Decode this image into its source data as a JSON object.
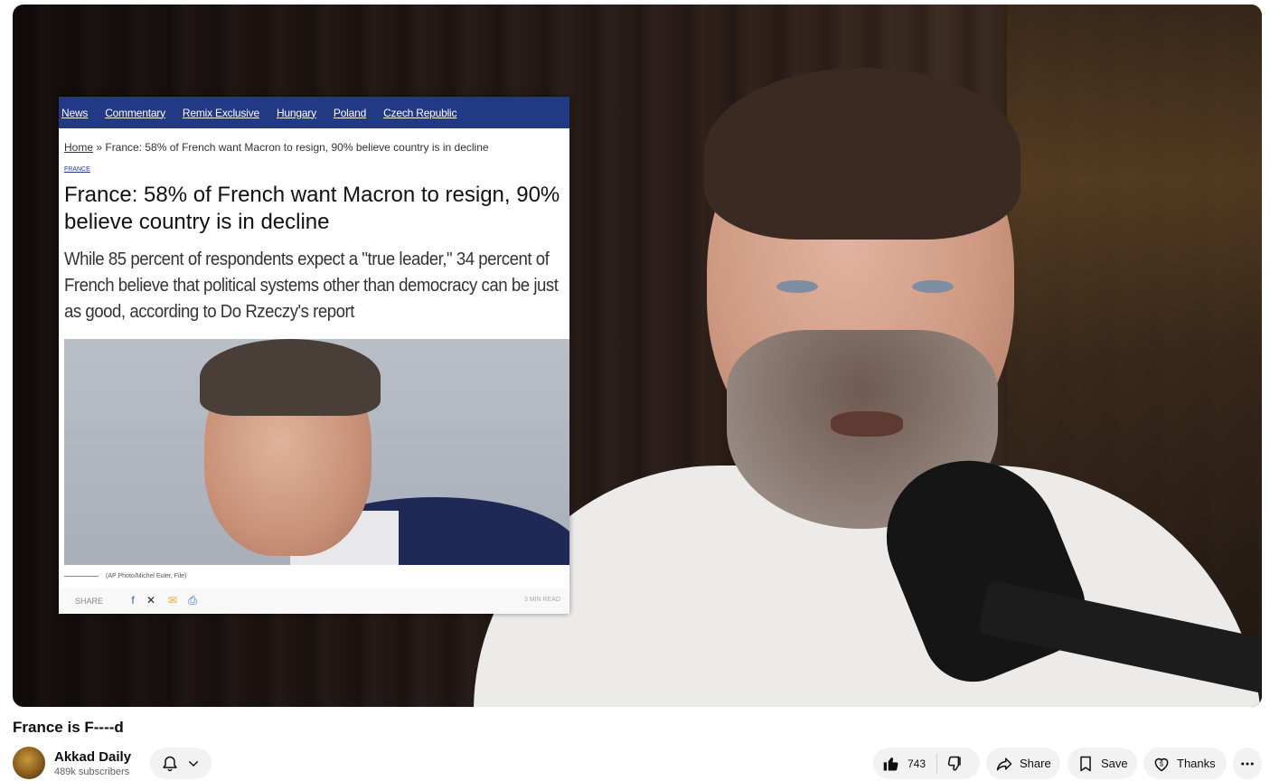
{
  "article": {
    "nav": [
      "News",
      "Commentary",
      "Remix Exclusive",
      "Hungary",
      "Poland",
      "Czech Republic"
    ],
    "breadcrumb_home": "Home",
    "breadcrumb_rest": " » France: 58% of French want Macron to resign, 90% believe country is in decline",
    "category": "FRANCE",
    "headline": "France: 58% of French want Macron to resign, 90% believe country is in decline",
    "dek": "While 85 percent of respondents expect a \"true leader,\" 34 percent of French believe that political systems other than democracy can be just as good, according to Do Rzeczy's report",
    "caption": "(AP Photo/Michel Euler, File)",
    "share_label": "SHARE",
    "read_time": "3 MIN READ"
  },
  "video": {
    "title": "France is F----d"
  },
  "channel": {
    "name": "Akkad Daily",
    "subscribers": "489k subscribers"
  },
  "actions": {
    "like_count": "743",
    "share_label": "Share",
    "save_label": "Save",
    "thanks_label": "Thanks"
  },
  "icons": {
    "bell": "bell-icon",
    "chevron": "chevron-down-icon",
    "like": "thumbs-up-icon",
    "dislike": "thumbs-down-icon",
    "share": "share-arrow-icon",
    "save": "bookmark-icon",
    "thanks": "thanks-dollar-icon",
    "more": "more-horizontal-icon"
  }
}
